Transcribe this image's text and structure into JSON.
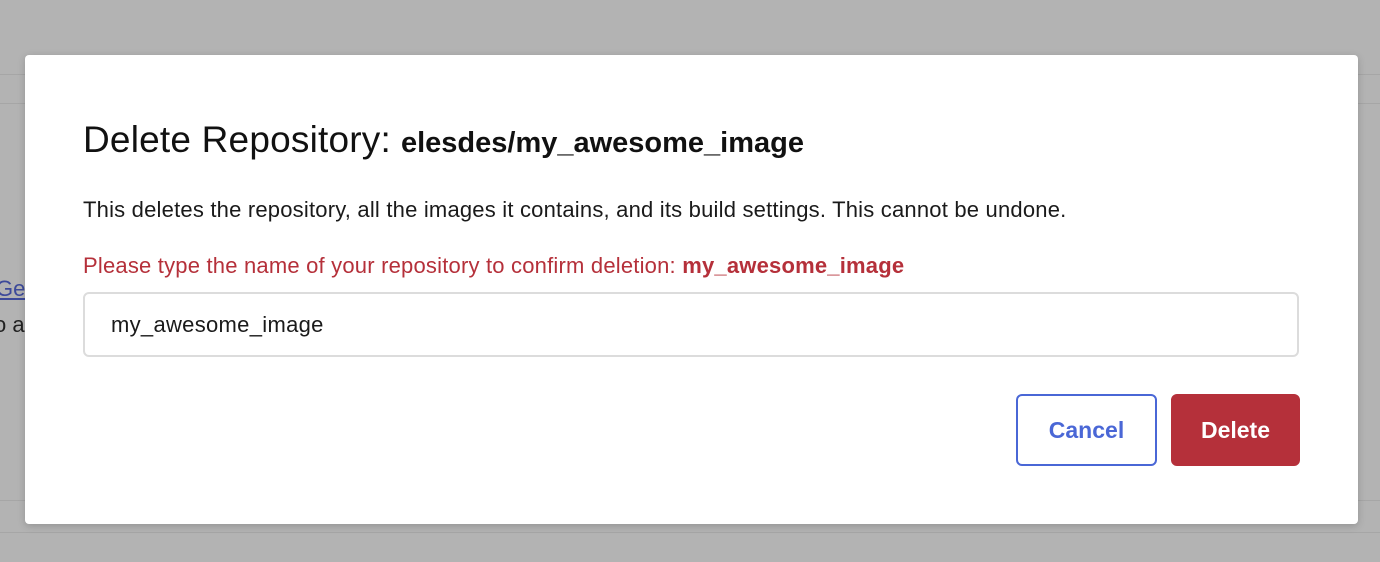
{
  "background": {
    "link_fragment": "Ge",
    "text_fragment": "o a"
  },
  "dialog": {
    "title": "Delete Repository:",
    "repo_full_name": "elesdes/my_awesome_image",
    "description": "This deletes the repository, all the images it contains, and its build settings. This cannot be undone.",
    "confirm_prompt": "Please type the name of your repository to confirm deletion:",
    "confirm_repo_name": "my_awesome_image",
    "input_value": "my_awesome_image",
    "cancel_label": "Cancel",
    "delete_label": "Delete"
  },
  "colors": {
    "danger": "#b5303a",
    "primary": "#4a67d6",
    "overlay": "#b3b3b3"
  }
}
